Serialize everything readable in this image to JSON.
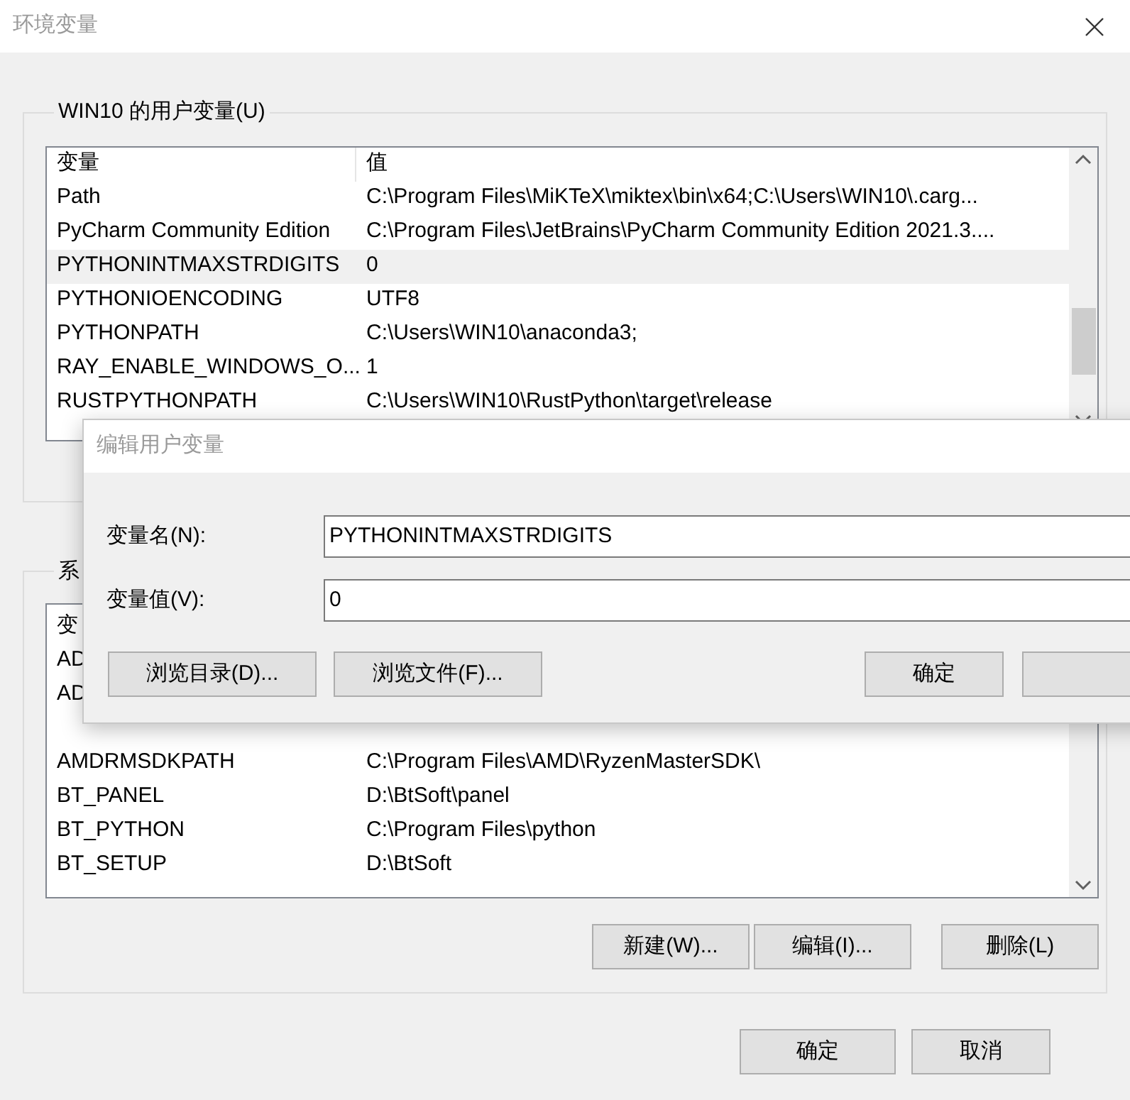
{
  "window": {
    "title": "环境变量"
  },
  "user_vars": {
    "title": "WIN10 的用户变量(U)",
    "columns": [
      "变量",
      "值"
    ],
    "rows": [
      {
        "name": "Path",
        "value": "C:\\Program Files\\MiKTeX\\miktex\\bin\\x64;C:\\Users\\WIN10\\.carg...",
        "selected": false
      },
      {
        "name": "PyCharm Community Edition",
        "value": "C:\\Program Files\\JetBrains\\PyCharm Community Edition 2021.3....",
        "selected": false
      },
      {
        "name": "PYTHONINTMAXSTRDIGITS",
        "value": "0",
        "selected": true
      },
      {
        "name": "PYTHONIOENCODING",
        "value": "UTF8",
        "selected": false
      },
      {
        "name": "PYTHONPATH",
        "value": "C:\\Users\\WIN10\\anaconda3;",
        "selected": false
      },
      {
        "name": "RAY_ENABLE_WINDOWS_O...",
        "value": "1",
        "selected": false
      },
      {
        "name": "RUSTPYTHONPATH",
        "value": "C:\\Users\\WIN10\\RustPython\\target\\release",
        "selected": false
      }
    ]
  },
  "system_vars": {
    "title": "系",
    "columns": [
      "变"
    ],
    "partial_rows": [
      {
        "name": "AD",
        "selected": false
      },
      {
        "name": "AD",
        "selected": false
      }
    ],
    "rows": [
      {
        "name": "AMDRMSDKPATH",
        "value": "C:\\Program Files\\AMD\\RyzenMasterSDK\\",
        "selected": false
      },
      {
        "name": "BT_PANEL",
        "value": "D:\\BtSoft\\panel",
        "selected": false
      },
      {
        "name": "BT_PYTHON",
        "value": "C:\\Program Files\\python",
        "selected": false
      },
      {
        "name": "BT_SETUP",
        "value": "D:\\BtSoft",
        "selected": false
      }
    ],
    "buttons": [
      "新建(W)...",
      "编辑(I)...",
      "删除(L)"
    ]
  },
  "footer_buttons": [
    "确定",
    "取消"
  ],
  "dialog": {
    "title": "编辑用户变量",
    "fields": [
      {
        "label": "变量名(N):",
        "value": "PYTHONINTMAXSTRDIGITS"
      },
      {
        "label": "变量值(V):",
        "value": "0"
      }
    ],
    "buttons": [
      "浏览目录(D)...",
      "浏览文件(F)...",
      "确定"
    ]
  }
}
